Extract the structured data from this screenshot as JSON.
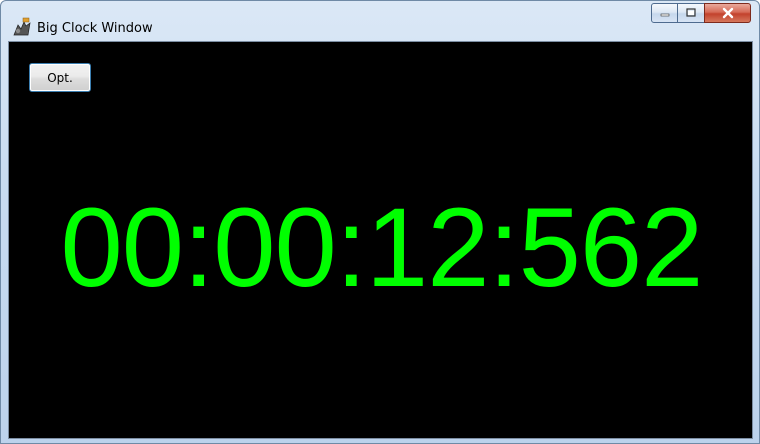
{
  "window": {
    "title": "Big Clock Window",
    "icon": "big-clock-app-icon"
  },
  "caption_buttons": {
    "minimize_icon": "minimize-icon",
    "maximize_icon": "maximize-icon",
    "close_icon": "close-icon"
  },
  "toolbar": {
    "options_label": "Opt."
  },
  "clock": {
    "time": "00:00:12:562",
    "color": "#00ff00",
    "background": "#000000"
  }
}
